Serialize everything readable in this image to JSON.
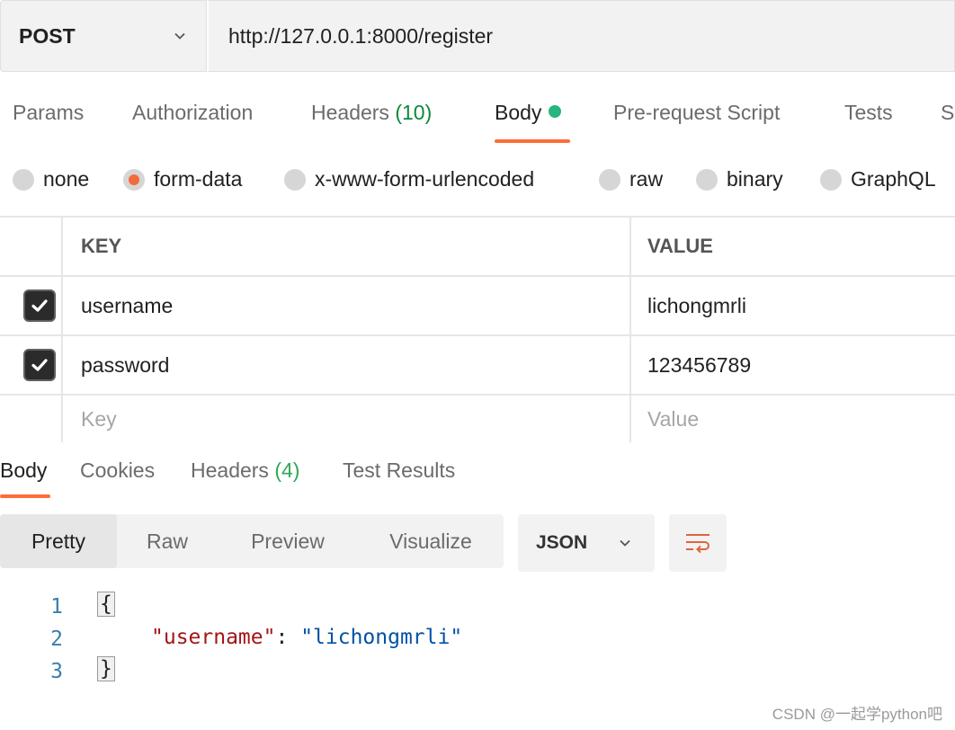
{
  "request": {
    "method": "POST",
    "url": "http://127.0.0.1:8000/register"
  },
  "request_tabs": {
    "params": "Params",
    "authorization": "Authorization",
    "headers": "Headers",
    "headers_count": "(10)",
    "body": "Body",
    "prerequest": "Pre-request Script",
    "tests": "Tests",
    "settings_partial": "S"
  },
  "body_types": {
    "none": "none",
    "form_data": "form-data",
    "urlencoded": "x-www-form-urlencoded",
    "raw": "raw",
    "binary": "binary",
    "graphql": "GraphQL",
    "selected": "form-data"
  },
  "kv_table": {
    "header_key": "KEY",
    "header_value": "VALUE",
    "rows": [
      {
        "key": "username",
        "value": "lichongmrli",
        "checked": true
      },
      {
        "key": "password",
        "value": "123456789",
        "checked": true
      }
    ],
    "placeholder_key": "Key",
    "placeholder_value": "Value"
  },
  "response_tabs": {
    "body": "Body",
    "cookies": "Cookies",
    "headers": "Headers",
    "headers_count": "(4)",
    "test_results": "Test Results"
  },
  "view_modes": {
    "pretty": "Pretty",
    "raw": "Raw",
    "preview": "Preview",
    "visualize": "Visualize",
    "format": "JSON"
  },
  "code": {
    "line_numbers": [
      "1",
      "2",
      "3"
    ],
    "open_brace": "{",
    "close_brace": "}",
    "key": "\"username\"",
    "colon": ": ",
    "value": "\"lichongmrli\""
  },
  "watermark": "CSDN @一起学python吧",
  "colors": {
    "accent": "#ff6c37",
    "status_dot": "#26b47f",
    "headers_count": "#0c8a3c",
    "json_key": "#a31515",
    "json_value": "#0451a5"
  }
}
